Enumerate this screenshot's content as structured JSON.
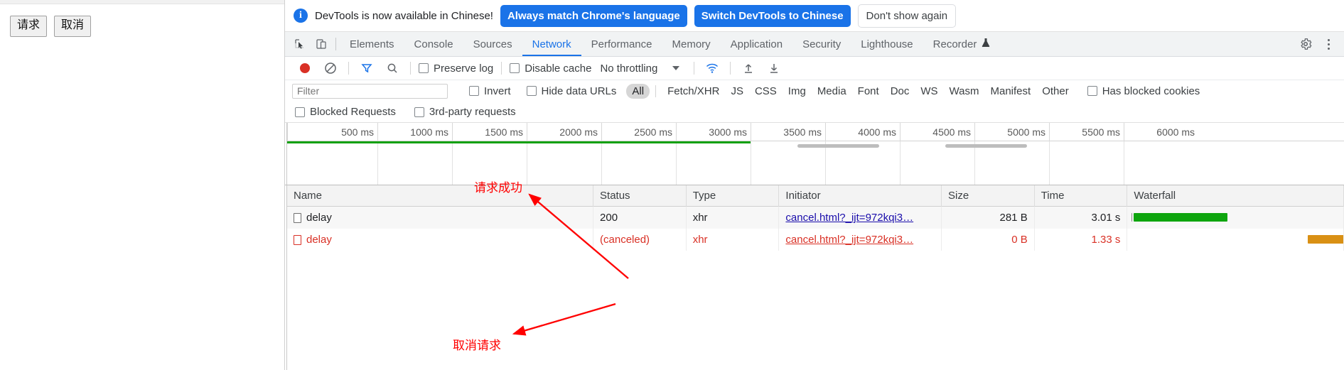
{
  "page": {
    "buttons": [
      {
        "label": "请求",
        "name": "request-button"
      },
      {
        "label": "取消",
        "name": "cancel-button"
      }
    ]
  },
  "devtools": {
    "info_banner": {
      "icon": "info-icon",
      "message": "DevTools is now available in Chinese!",
      "primary_action": "Always match Chrome's language",
      "secondary_action": "Switch DevTools to Chinese",
      "dismiss_action": "Don't show again"
    },
    "tabs": [
      {
        "label": "Elements",
        "active": false
      },
      {
        "label": "Console",
        "active": false
      },
      {
        "label": "Sources",
        "active": false
      },
      {
        "label": "Network",
        "active": true
      },
      {
        "label": "Performance",
        "active": false
      },
      {
        "label": "Memory",
        "active": false
      },
      {
        "label": "Application",
        "active": false
      },
      {
        "label": "Security",
        "active": false
      },
      {
        "label": "Lighthouse",
        "active": false
      },
      {
        "label": "Recorder",
        "active": false
      }
    ],
    "network_toolbar": {
      "record_title": "record",
      "clear_title": "clear",
      "filter_title": "filter",
      "search_title": "search",
      "preserve_log": "Preserve log",
      "disable_cache": "Disable cache",
      "throttling": "No throttling",
      "import_title": "import-har",
      "export_title": "export-har",
      "wifi_title": "network-conditions"
    },
    "filter_row": {
      "placeholder": "Filter",
      "value": "",
      "invert": "Invert",
      "hide_data_urls": "Hide data URLs",
      "types": [
        {
          "label": "All",
          "active": true
        },
        {
          "label": "Fetch/XHR",
          "active": false
        },
        {
          "label": "JS",
          "active": false
        },
        {
          "label": "CSS",
          "active": false
        },
        {
          "label": "Img",
          "active": false
        },
        {
          "label": "Media",
          "active": false
        },
        {
          "label": "Font",
          "active": false
        },
        {
          "label": "Doc",
          "active": false
        },
        {
          "label": "WS",
          "active": false
        },
        {
          "label": "Wasm",
          "active": false
        },
        {
          "label": "Manifest",
          "active": false
        },
        {
          "label": "Other",
          "active": false
        }
      ],
      "has_blocked_cookies": "Has blocked cookies",
      "blocked_requests": "Blocked Requests",
      "third_party_requests": "3rd-party requests"
    },
    "overview": {
      "ticks": [
        "500 ms",
        "1000 ms",
        "1500 ms",
        "2000 ms",
        "2500 ms",
        "3000 ms",
        "3500 ms",
        "4000 ms",
        "4500 ms",
        "5000 ms",
        "5500 ms",
        "6000 ms"
      ],
      "green_bar_color": "#13a10e"
    },
    "table": {
      "columns": [
        "Name",
        "Status",
        "Type",
        "Initiator",
        "Size",
        "Time",
        "Waterfall"
      ],
      "rows": [
        {
          "name": "delay",
          "status": "200",
          "type": "xhr",
          "initiator": "cancel.html?_ijt=972kqi3…",
          "size": "281 B",
          "time": "3.01 s",
          "error": false,
          "waterfall_color": "#0ea50e"
        },
        {
          "name": "delay",
          "status": "(canceled)",
          "type": "xhr",
          "initiator": "cancel.html?_ijt=972kqi3…",
          "size": "0 B",
          "time": "1.33 s",
          "error": true,
          "waterfall_color": "#d99014"
        }
      ]
    },
    "annotations": [
      {
        "text": "请求成功",
        "name": "annotation-request-success",
        "color": "#ff0000"
      },
      {
        "text": "取消请求",
        "name": "annotation-cancel-request",
        "color": "#ff0000"
      }
    ]
  }
}
